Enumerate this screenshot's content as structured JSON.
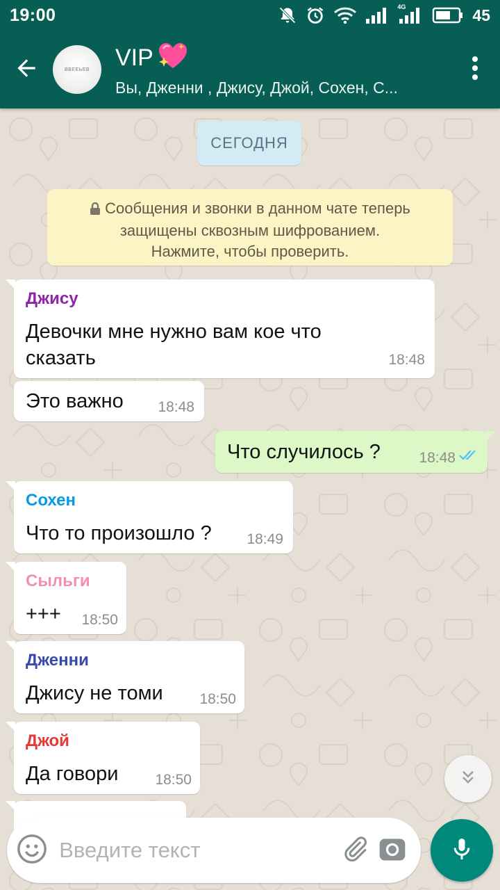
{
  "status_bar": {
    "time": "19:00",
    "battery": "45",
    "network_label": "4G",
    "icons": [
      "muted-bell-icon",
      "alarm-icon",
      "wifi-icon",
      "signal-icon",
      "signal-4g-icon",
      "battery-icon"
    ]
  },
  "header": {
    "title": "VIP",
    "title_emoji": "💖",
    "members": "Вы, Дженни , Джису, Джой, Сохен, С...",
    "avatar_text": "ВВЕЕЬЕВ",
    "back_icon": "arrow-back-icon",
    "menu_icon": "more-vert-icon"
  },
  "chat": {
    "date_chip": "СЕГОДНЯ",
    "system_message": {
      "line1": "Сообщения и звонки в данном чате теперь",
      "line2": "защищены сквозным шифрованием.",
      "line3": "Нажмите, чтобы проверить.",
      "icon": "lock-icon"
    },
    "messages": [
      {
        "sender": "Джису",
        "sender_color": "#8e24aa",
        "line1": "Девочки мне нужно вам кое что",
        "line2": "сказать",
        "time": "18:48",
        "direction": "in"
      },
      {
        "sender": "",
        "text": "Это важно",
        "time": "18:48",
        "direction": "in"
      },
      {
        "sender": "",
        "text": "Что случилось ?",
        "time": "18:48",
        "direction": "out",
        "status": "read"
      },
      {
        "sender": "Сохен",
        "sender_color": "#039be5",
        "text": "Что то произошло ?",
        "time": "18:49",
        "direction": "in"
      },
      {
        "sender": "Сыльги",
        "sender_color": "#f48fb1",
        "text": "+++",
        "time": "18:50",
        "direction": "in"
      },
      {
        "sender": "Дженни",
        "sender_color": "#3949ab",
        "text": "Джису не томи",
        "time": "18:50",
        "direction": "in"
      },
      {
        "sender": "Джой",
        "sender_color": "#e53935",
        "text": "Да говори",
        "time": "18:50",
        "direction": "in"
      }
    ]
  },
  "input": {
    "placeholder": "Введите текст",
    "emoji_icon": "emoji-icon",
    "attach_icon": "paperclip-icon",
    "camera_icon": "camera-icon",
    "mic_icon": "microphone-icon",
    "scroll_icon": "double-chevron-down-icon"
  },
  "colors": {
    "header": "#075e54",
    "outgoing_bubble": "#dcf8c6",
    "incoming_bubble": "#ffffff",
    "mic_button": "#00897b",
    "read_ticks": "#4fc3f7"
  }
}
